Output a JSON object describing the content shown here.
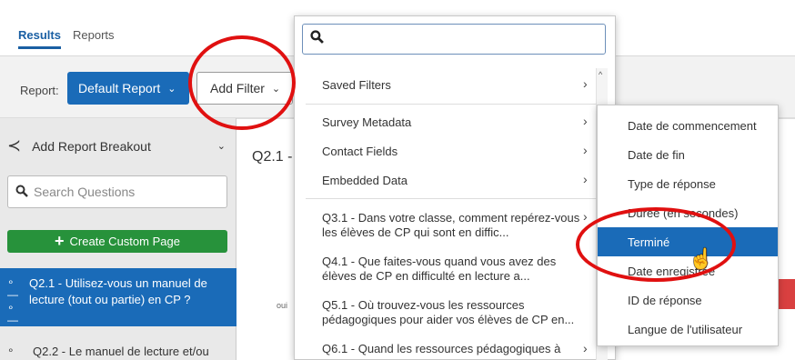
{
  "tabs": {
    "results": "Results",
    "reports": "Reports"
  },
  "toolbar": {
    "report_label": "Report:",
    "report_button": "Default Report",
    "add_filter": "Add Filter"
  },
  "sidebar": {
    "breakout": "Add Report Breakout",
    "search_placeholder": "Search Questions",
    "custom_page": "Create Custom Page",
    "questions": [
      {
        "id": "Q2.1",
        "text": "Q2.1 - Utilisez-vous un manuel de lecture (tout ou partie) en CP ?"
      },
      {
        "id": "Q2.2",
        "text": "Q2.2 - Le manuel de lecture et/ou"
      }
    ]
  },
  "main": {
    "title": "Q2.1 -",
    "oui": "oui"
  },
  "dropdown": {
    "search_value": "",
    "saved_filters": "Saved Filters",
    "survey_metadata": "Survey Metadata",
    "contact_fields": "Contact Fields",
    "embedded_data": "Embedded Data",
    "questions": [
      "Q3.1 - Dans votre classe, comment repérez-vous les élèves de CP qui sont en diffic...",
      "Q4.1 - Que faites-vous quand vous avez des élèves de CP en difficulté en lecture a...",
      "Q5.1 - Où trouvez-vous les ressources pédagogiques pour aider vos élèves de CP en...",
      "Q6.1 - Quand les ressources pédagogiques à"
    ]
  },
  "submenu": {
    "items": [
      "Date de commencement",
      "Date de fin",
      "Type de réponse",
      "Durée (en secondes)",
      "Terminé",
      "Date enregistrée",
      "ID de réponse",
      "Langue de l'utilisateur"
    ],
    "active_index": 4
  },
  "colors": {
    "accent": "#1a6bb8",
    "green": "#27923b",
    "annotation_red": "#e01010"
  },
  "icons": {
    "search": "search-icon",
    "breakout": "breakout-icon",
    "question": "question-list-icon",
    "chevron": "chevron-right-icon",
    "cursor": "hand-cursor-icon"
  }
}
